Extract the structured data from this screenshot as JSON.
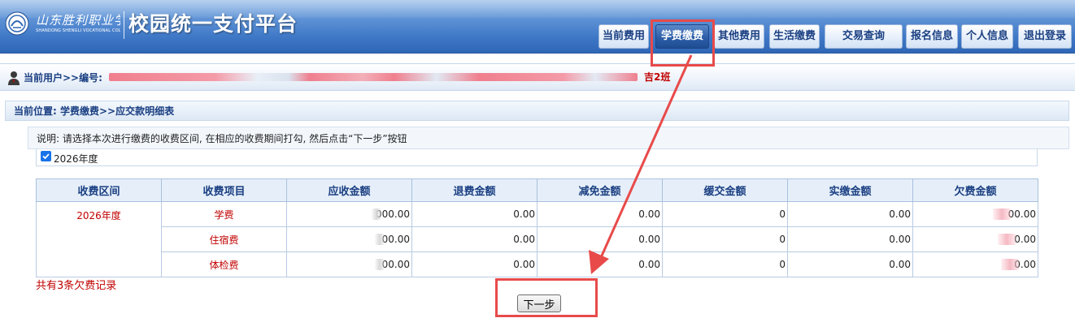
{
  "header": {
    "logo_calligraphy": "山东胜利职业学院",
    "logo_english": "SHANDONG SHENGLI VOCATIONAL COLLEGE",
    "app_title": "校园统一支付平台",
    "nav": [
      {
        "label": "当前费用",
        "active": false
      },
      {
        "label": "学费缴费",
        "active": true
      },
      {
        "label": "其他费用",
        "active": false
      },
      {
        "label": "生活缴费",
        "active": false
      },
      {
        "label": "交易查询",
        "active": false
      },
      {
        "label": "报名信息",
        "active": false
      },
      {
        "label": "个人信息",
        "active": false
      },
      {
        "label": "退出登录",
        "active": false
      }
    ]
  },
  "user_bar": {
    "label": "当前用户>>编号:",
    "class_suffix": "吉2班"
  },
  "breadcrumb": "当前位置: 学费缴费>>应交款明细表",
  "instructions": "说明: 请选择本次进行缴费的收费区间, 在相应的收费期间打勾, 然后点击“下一步”按钮",
  "period_option": {
    "label": "2026年度",
    "checked": true
  },
  "table": {
    "headers": [
      "收费区间",
      "收费项目",
      "应收金额",
      "退费金额",
      "减免金额",
      "缓交金额",
      "实缴金额",
      "欠费金额"
    ],
    "period": "2026年度",
    "rows": [
      {
        "item": "学费",
        "receivable": "000.00",
        "refund": "0.00",
        "waiver": "0.00",
        "deferred": "0",
        "paid": "0.00",
        "owed": "00.00"
      },
      {
        "item": "住宿费",
        "receivable": "00.00",
        "refund": "0.00",
        "waiver": "0.00",
        "deferred": "0",
        "paid": "0.00",
        "owed": "0.00"
      },
      {
        "item": "体检费",
        "receivable": "00.00",
        "refund": "0.00",
        "waiver": "0.00",
        "deferred": "0",
        "paid": "0.00",
        "owed": "0.00"
      }
    ]
  },
  "summary": "共有3条欠费记录",
  "next_button": "下一步",
  "colors": {
    "accent": "#2d5ea8",
    "warning_text": "#c00000",
    "annotation": "#e84a4a"
  }
}
